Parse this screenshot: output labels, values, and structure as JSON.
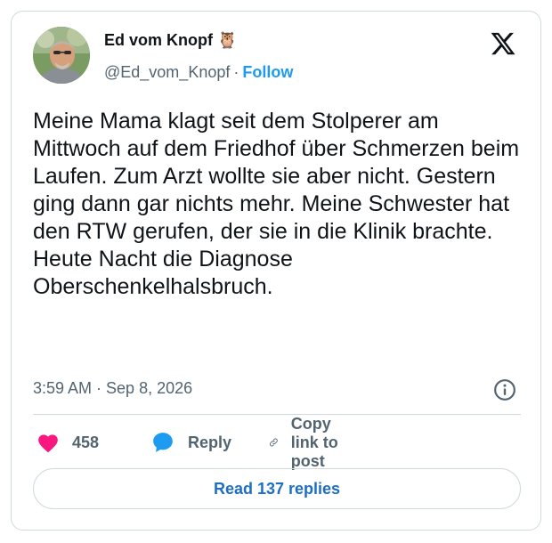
{
  "author": {
    "name": "Ed vom Knopf 🦉",
    "handle": "@Ed_vom_Knopf",
    "separator": "·",
    "follow_label": "Follow",
    "avatar_icon": "profile-photo"
  },
  "brand": {
    "logo_icon": "x-logo-icon",
    "color": "#0f1419"
  },
  "tweet": {
    "text": "Meine Mama klagt seit dem Stolperer am Mittwoch auf dem Friedhof über Schmerzen beim Laufen. Zum Arzt wollte sie aber nicht. Gestern ging dann gar nichts mehr. Meine Schwester hat den RTW gerufen, der sie in die Klinik brachte. Heute Nacht die Diagnose Oberschenkelhalsbruch.",
    "timestamp": "3:59 AM · Sep 8, 2026",
    "info_icon": "info-icon"
  },
  "actions": {
    "like_count": "458",
    "reply_label": "Reply",
    "copy_label": "Copy link to post"
  },
  "footer": {
    "read_replies_label": "Read 137 replies"
  },
  "colors": {
    "accent": "#1d9bf0",
    "like": "#f91880",
    "muted": "#536471",
    "border": "#cfd9de"
  }
}
